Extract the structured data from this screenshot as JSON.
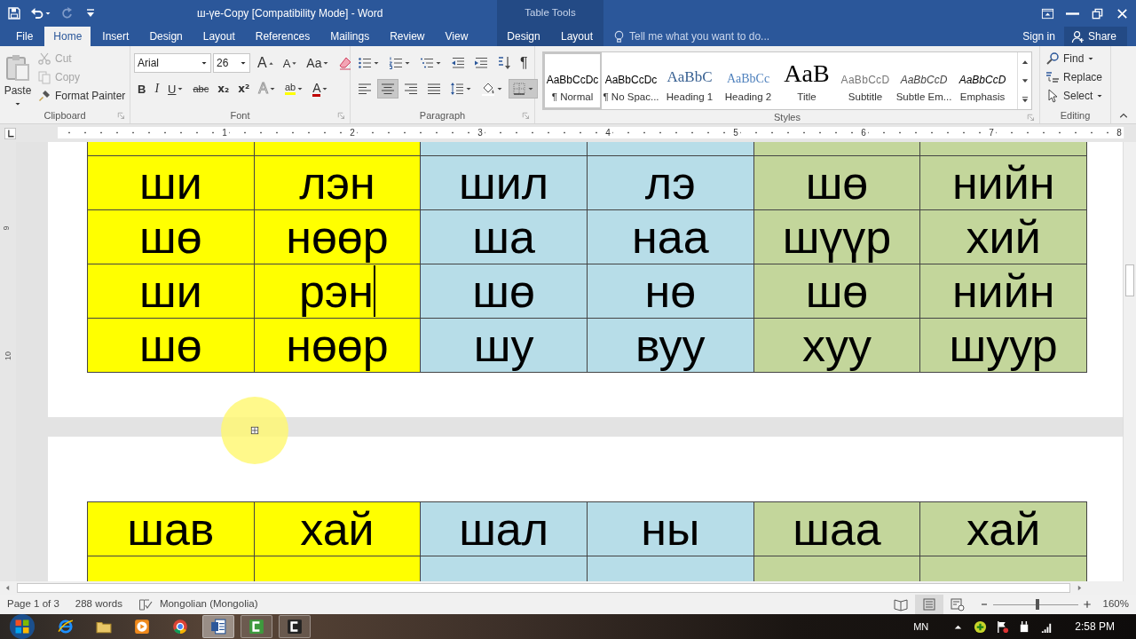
{
  "title_bar": {
    "quick_access": [
      {
        "kind": "save",
        "disabled": false,
        "caret": false
      },
      {
        "kind": "undo",
        "disabled": false,
        "caret": true
      },
      {
        "kind": "redo",
        "disabled": true,
        "caret": false
      },
      {
        "kind": "customize",
        "disabled": false,
        "caret": false
      }
    ],
    "title": "ш-үе-Copy [Compatibility Mode] - Word",
    "contextual_title": "Table Tools"
  },
  "tabs": [
    {
      "label": "File",
      "selected": false,
      "contextual": false
    },
    {
      "label": "Home",
      "selected": true,
      "contextual": false
    },
    {
      "label": "Insert",
      "selected": false,
      "contextual": false
    },
    {
      "label": "Design",
      "selected": false,
      "contextual": false
    },
    {
      "label": "Layout",
      "selected": false,
      "contextual": false
    },
    {
      "label": "References",
      "selected": false,
      "contextual": false
    },
    {
      "label": "Mailings",
      "selected": false,
      "contextual": false
    },
    {
      "label": "Review",
      "selected": false,
      "contextual": false
    },
    {
      "label": "View",
      "selected": false,
      "contextual": false
    },
    {
      "label": "Design",
      "selected": false,
      "contextual": true
    },
    {
      "label": "Layout",
      "selected": false,
      "contextual": true
    }
  ],
  "tell_me": {
    "placeholder": "Tell me what you want to do..."
  },
  "account": {
    "sign_in": "Sign in",
    "share": "Share"
  },
  "ribbon": {
    "clipboard": {
      "label": "Clipboard",
      "paste": "Paste",
      "commands": [
        {
          "kind": "cut",
          "label": "Cut",
          "disabled": true
        },
        {
          "kind": "copy",
          "label": "Copy",
          "disabled": true
        },
        {
          "kind": "painter",
          "label": "Format Painter",
          "disabled": false
        }
      ]
    },
    "font": {
      "label": "Font",
      "font_name": "Arial",
      "font_size": "26",
      "row_1": [
        {
          "kind": "grow",
          "text": "A",
          "caret": false,
          "selected": false
        },
        {
          "kind": "shrink",
          "text": "A",
          "caret": false,
          "selected": false
        },
        {
          "kind": "case",
          "text": "Aa",
          "caret": true,
          "selected": false
        },
        {
          "kind": "clear",
          "caret": false,
          "selected": false
        }
      ],
      "row_2": [
        {
          "kind": "bold",
          "text": "B",
          "caret": false,
          "selected": false
        },
        {
          "kind": "italic",
          "text": "I",
          "caret": false,
          "selected": false
        },
        {
          "kind": "underline",
          "text": "U",
          "caret": true,
          "selected": false
        },
        {
          "kind": "strike",
          "text": "abc",
          "caret": false,
          "selected": false
        },
        {
          "kind": "sub",
          "text": "x₂",
          "caret": false,
          "selected": false
        },
        {
          "kind": "sup",
          "text": "x²",
          "caret": false,
          "selected": false
        },
        {
          "kind": "effects",
          "text": "A",
          "caret": true,
          "selected": false
        },
        {
          "kind": "highlight",
          "text": "ab",
          "caret": true,
          "selected": false
        },
        {
          "kind": "color",
          "text": "A",
          "caret": true,
          "selected": false
        }
      ]
    },
    "paragraph": {
      "label": "Paragraph",
      "row_1": [
        {
          "kind": "bullets",
          "caret": true,
          "selected": false
        },
        {
          "kind": "numbering",
          "caret": true,
          "selected": false
        },
        {
          "kind": "multilevel",
          "caret": true,
          "selected": false
        },
        {
          "kind": "outdent",
          "caret": false,
          "selected": false
        },
        {
          "kind": "indent",
          "caret": false,
          "selected": false
        },
        {
          "kind": "sort",
          "caret": false,
          "selected": false
        },
        {
          "kind": "pilcrow",
          "text": "¶",
          "caret": false,
          "selected": false
        }
      ],
      "row_2": [
        {
          "kind": "alignleft",
          "caret": false,
          "selected": false
        },
        {
          "kind": "aligncenter",
          "caret": false,
          "selected": true
        },
        {
          "kind": "alignright",
          "caret": false,
          "selected": false
        },
        {
          "kind": "justify",
          "caret": false,
          "selected": false
        },
        {
          "kind": "spacing",
          "caret": true,
          "selected": false
        },
        {
          "kind": "shading",
          "caret": true,
          "selected": false
        },
        {
          "kind": "borders",
          "caret": true,
          "selected": true
        }
      ]
    },
    "styles": {
      "label": "Styles",
      "items": [
        {
          "kind": "normal",
          "preview": "AaBbCcDc",
          "name": "¶ Normal",
          "selected": true
        },
        {
          "kind": "normal",
          "preview": "AaBbCcDc",
          "name": "¶ No Spac...",
          "selected": false
        },
        {
          "kind": "heading1",
          "preview": "AaBbC",
          "name": "Heading 1",
          "selected": false
        },
        {
          "kind": "heading2",
          "preview": "AaBbCc",
          "name": "Heading 2",
          "selected": false
        },
        {
          "kind": "title",
          "preview": "AaB",
          "name": "Title",
          "selected": false
        },
        {
          "kind": "subtitle",
          "preview": "AaBbCcD",
          "name": "Subtitle",
          "selected": false
        },
        {
          "kind": "subtle",
          "preview": "AaBbCcD",
          "name": "Subtle Em...",
          "selected": false
        },
        {
          "kind": "emphasis",
          "preview": "AaBbCcD",
          "name": "Emphasis",
          "selected": false
        }
      ]
    },
    "editing": {
      "label": "Editing",
      "commands": [
        {
          "kind": "find",
          "label": "Find",
          "caret": true
        },
        {
          "kind": "replace",
          "label": "Replace",
          "caret": false
        },
        {
          "kind": "select",
          "label": "Select",
          "caret": true
        }
      ]
    }
  },
  "ruler": {
    "labels": [
      "1",
      "2",
      "3",
      "4",
      "5",
      "6",
      "7",
      "8"
    ]
  },
  "vertical_ruler": {
    "labels": [
      "9",
      "10"
    ]
  },
  "document": {
    "columns": [
      {
        "color": "#ffff00"
      },
      {
        "color": "#ffff00"
      },
      {
        "color": "#b7dde8"
      },
      {
        "color": "#b7dde8"
      },
      {
        "color": "#c3d69b"
      },
      {
        "color": "#c3d69b"
      }
    ],
    "pages": [
      {
        "cut_row_above": true,
        "cut_row_below": false,
        "rows": [
          {
            "cells": [
              {
                "text": "ши",
                "cursor": false
              },
              {
                "text": "лэн",
                "cursor": false
              },
              {
                "text": "шил",
                "cursor": false
              },
              {
                "text": "лэ",
                "cursor": false
              },
              {
                "text": "шө",
                "cursor": false
              },
              {
                "text": "нийн",
                "cursor": false
              }
            ]
          },
          {
            "cells": [
              {
                "text": "шө",
                "cursor": false
              },
              {
                "text": "нөөр",
                "cursor": false
              },
              {
                "text": "ша",
                "cursor": false
              },
              {
                "text": "наа",
                "cursor": false
              },
              {
                "text": "шүүр",
                "cursor": false
              },
              {
                "text": "хий",
                "cursor": false
              }
            ]
          },
          {
            "cells": [
              {
                "text": "ши",
                "cursor": false
              },
              {
                "text": "рэн",
                "cursor": true
              },
              {
                "text": "шө",
                "cursor": false
              },
              {
                "text": "нө",
                "cursor": false
              },
              {
                "text": "шө",
                "cursor": false
              },
              {
                "text": "нийн",
                "cursor": false
              }
            ]
          },
          {
            "cells": [
              {
                "text": "шө",
                "cursor": false
              },
              {
                "text": "нөөр",
                "cursor": false
              },
              {
                "text": "шу",
                "cursor": false
              },
              {
                "text": "вуу",
                "cursor": false
              },
              {
                "text": "хуу",
                "cursor": false
              },
              {
                "text": "шуур",
                "cursor": false
              }
            ]
          }
        ]
      },
      {
        "cut_row_above": false,
        "cut_row_below": true,
        "rows": [
          {
            "cells": [
              {
                "text": "шав",
                "cursor": false
              },
              {
                "text": "хай",
                "cursor": false
              },
              {
                "text": "шал",
                "cursor": false
              },
              {
                "text": "ны",
                "cursor": false
              },
              {
                "text": "шаа",
                "cursor": false
              },
              {
                "text": "хай",
                "cursor": false
              }
            ]
          }
        ]
      }
    ]
  },
  "status_bar": {
    "page": "Page 1 of 3",
    "words": "288 words",
    "language": "Mongolian (Mongolia)",
    "views": [
      {
        "kind": "read",
        "selected": false
      },
      {
        "kind": "print",
        "selected": true
      },
      {
        "kind": "web",
        "selected": false
      }
    ],
    "zoom": {
      "level": 0.53,
      "reading": "160%"
    }
  },
  "taskbar": {
    "apps": [
      {
        "kind": "ie",
        "running": false,
        "selected": false
      },
      {
        "kind": "folder",
        "running": false,
        "selected": false
      },
      {
        "kind": "media",
        "running": false,
        "selected": false
      },
      {
        "kind": "chrome",
        "running": false,
        "selected": false
      },
      {
        "kind": "word",
        "running": true,
        "selected": true
      },
      {
        "kind": "camtasia",
        "running": true,
        "selected": false
      },
      {
        "kind": "camtasia2",
        "running": true,
        "selected": false
      }
    ],
    "language": "MN",
    "time": "2:58 PM"
  }
}
